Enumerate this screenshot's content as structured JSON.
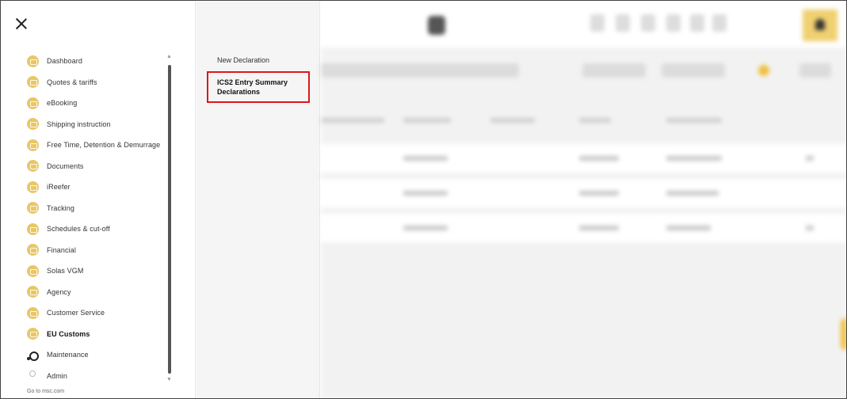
{
  "nav": {
    "close_label": "×",
    "items": [
      {
        "label": "Dashboard",
        "icon": "dashboard-icon"
      },
      {
        "label": "Quotes & tariffs",
        "icon": "quotes-icon"
      },
      {
        "label": "eBooking",
        "icon": "ebooking-icon"
      },
      {
        "label": "Shipping instruction",
        "icon": "shipping-instruction-icon"
      },
      {
        "label": "Free Time, Detention & Demurrage",
        "icon": "free-time-icon"
      },
      {
        "label": "Documents",
        "icon": "documents-icon"
      },
      {
        "label": "iReefer",
        "icon": "ireefer-icon"
      },
      {
        "label": "Tracking",
        "icon": "tracking-icon"
      },
      {
        "label": "Schedules & cut-off",
        "icon": "schedules-icon"
      },
      {
        "label": "Financial",
        "icon": "financial-icon"
      },
      {
        "label": "Solas VGM",
        "icon": "solas-vgm-icon"
      },
      {
        "label": "Agency",
        "icon": "agency-icon"
      },
      {
        "label": "Customer Service",
        "icon": "customer-service-icon"
      },
      {
        "label": "EU Customs",
        "icon": "eu-customs-icon",
        "active": true
      },
      {
        "label": "Maintenance",
        "icon": "gear-icon"
      },
      {
        "label": "Admin",
        "icon": "admin-icon"
      }
    ],
    "footer_link": "Go to msc.com"
  },
  "submenu": {
    "items": [
      {
        "label": "New Declaration"
      },
      {
        "label": "ICS2 Entry Summary Declarations",
        "highlighted": true
      }
    ]
  },
  "colors": {
    "accent": "#e8c766",
    "highlight_border": "#e0161b"
  }
}
